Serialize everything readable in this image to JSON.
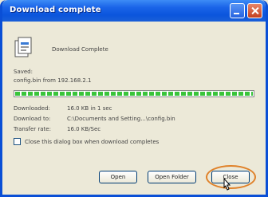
{
  "window": {
    "title": "Download complete",
    "minimize_icon": "minimize-icon",
    "close_icon": "close-icon"
  },
  "content": {
    "icon": "download-complete-icon",
    "heading": "Download Complete",
    "saved_label": "Saved:",
    "filename": "config.bin from 192.168.2.1",
    "progress_percent": 100,
    "progress_color": "#39c43a",
    "rows": [
      {
        "label": "Downloaded:",
        "value": "16.0 KB in 1 sec"
      },
      {
        "label": "Download to:",
        "value": "C:\\Documents and Setting...\\config.bin"
      },
      {
        "label": "Transfer rate:",
        "value": "16.0 KB/Sec"
      }
    ],
    "checkbox_label": "Close this dialog box when download completes",
    "checkbox_checked": false
  },
  "buttons": {
    "open": "Open",
    "open_folder": "Open Folder",
    "close": "Close"
  },
  "highlight_color": "#e0822a"
}
